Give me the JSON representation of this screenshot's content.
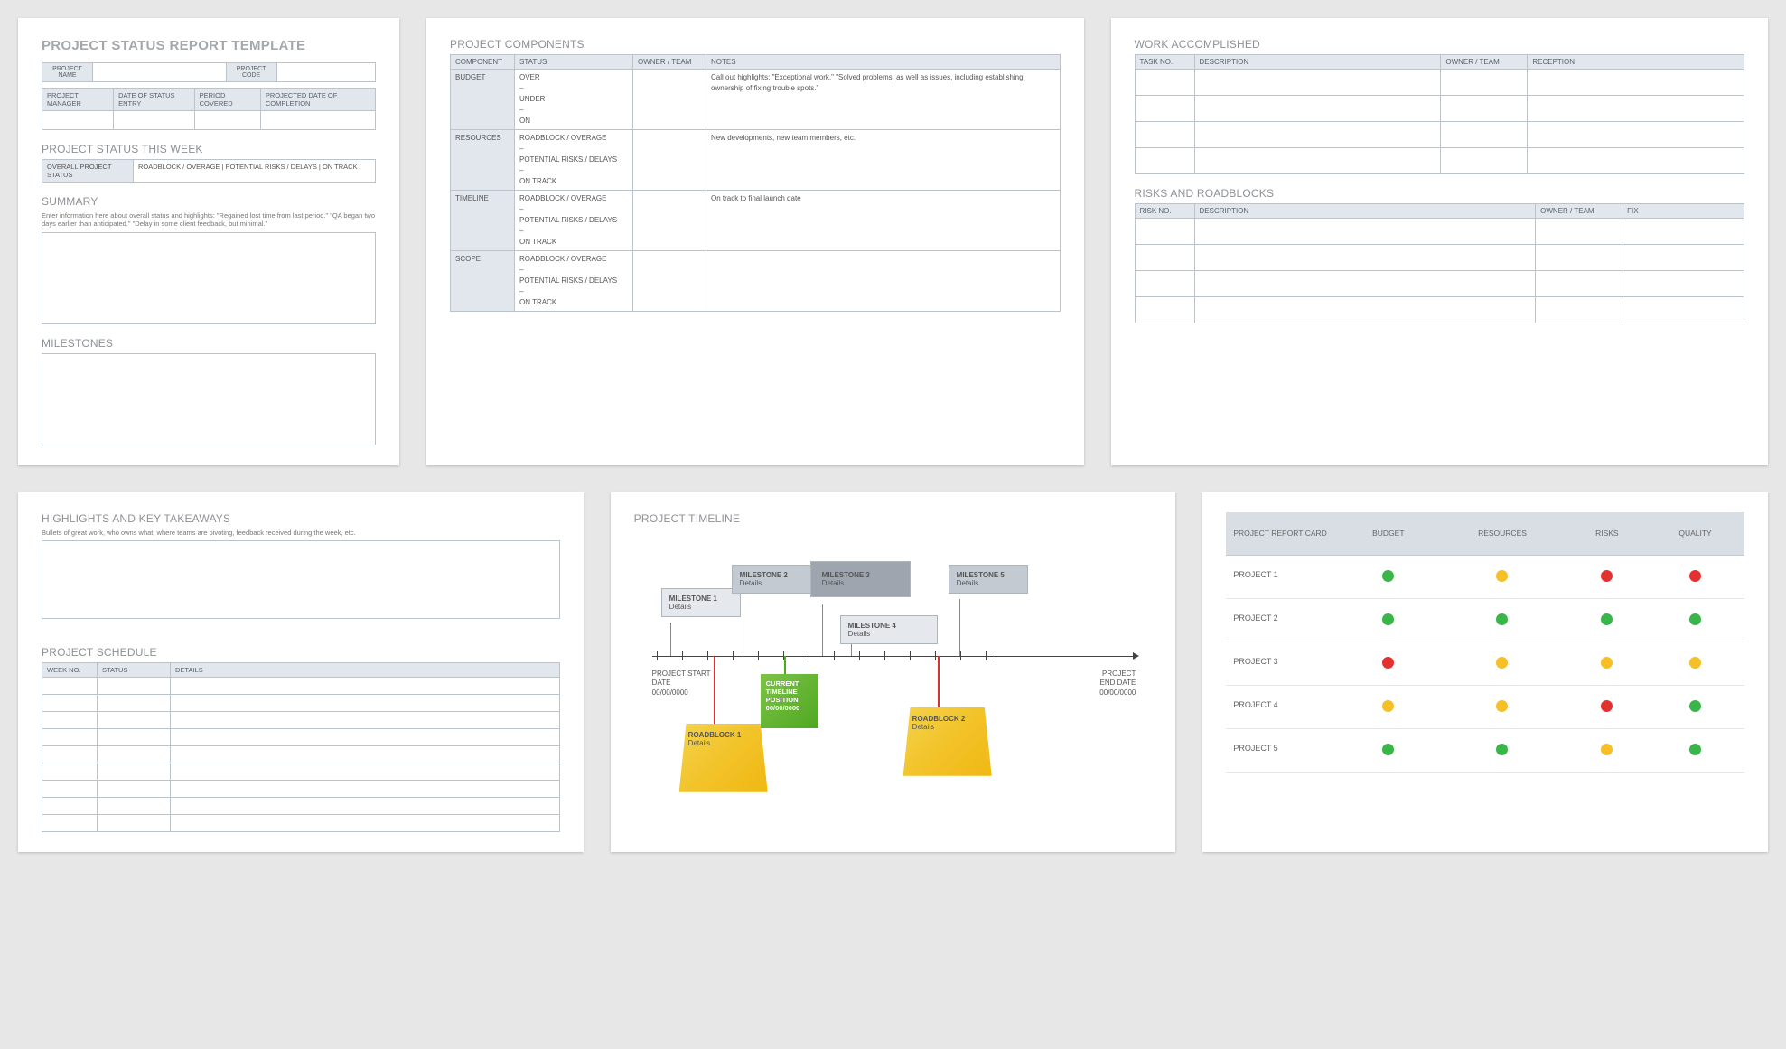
{
  "page1": {
    "title": "PROJECT STATUS REPORT TEMPLATE",
    "hdr1": {
      "name_lbl": "PROJECT NAME",
      "code_lbl": "PROJECT CODE"
    },
    "hdr2": {
      "c1": "PROJECT MANAGER",
      "c2": "DATE OF STATUS ENTRY",
      "c3": "PERIOD COVERED",
      "c4": "PROJECTED DATE OF COMPLETION"
    },
    "status_week": "PROJECT STATUS THIS WEEK",
    "status_lbl": "OVERALL PROJECT STATUS",
    "status_opts": "ROADBLOCK / OVERAGE    |    POTENTIAL RISKS / DELAYS    |    ON TRACK",
    "summary": "SUMMARY",
    "summary_hint": "Enter information here about overall status and highlights: \"Regained lost time from last period.\" \"QA began two days earlier than anticipated.\" \"Delay in some client feedback, but minimal.\"",
    "milestones": "MILESTONES"
  },
  "page2": {
    "title": "PROJECT COMPONENTS",
    "cols": {
      "c1": "COMPONENT",
      "c2": "STATUS",
      "c3": "OWNER / TEAM",
      "c4": "NOTES"
    },
    "rows": [
      {
        "name": "BUDGET",
        "status": "OVER\n–\nUNDER\n–\nON",
        "notes": "Call out highlights: \"Exceptional work.\" \"Solved problems, as well as issues, including establishing ownership of fixing trouble spots.\""
      },
      {
        "name": "RESOURCES",
        "status": "ROADBLOCK / OVERAGE\n–\nPOTENTIAL RISKS / DELAYS\n–\nON TRACK",
        "notes": "New developments, new team members, etc."
      },
      {
        "name": "TIMELINE",
        "status": "ROADBLOCK / OVERAGE\n–\nPOTENTIAL RISKS / DELAYS\n–\nON TRACK",
        "notes": "On track to final launch date"
      },
      {
        "name": "SCOPE",
        "status": "ROADBLOCK / OVERAGE\n–\nPOTENTIAL RISKS / DELAYS\n–\nON TRACK",
        "notes": ""
      }
    ]
  },
  "page3": {
    "wa_title": "WORK ACCOMPLISHED",
    "wa_cols": {
      "c1": "TASK NO.",
      "c2": "DESCRIPTION",
      "c3": "OWNER / TEAM",
      "c4": "RECEPTION"
    },
    "rr_title": "RISKS AND ROADBLOCKS",
    "rr_cols": {
      "c1": "RISK NO.",
      "c2": "DESCRIPTION",
      "c3": "OWNER / TEAM",
      "c4": "FIX"
    }
  },
  "page4": {
    "hl_title": "HIGHLIGHTS AND KEY TAKEAWAYS",
    "hl_hint": "Bullets of great work, who owns what, where teams are pivoting, feedback received during the week, etc.",
    "sched_title": "PROJECT SCHEDULE",
    "sched_cols": {
      "c1": "WEEK NO.",
      "c2": "STATUS",
      "c3": "DETAILS"
    }
  },
  "page5": {
    "title": "PROJECT TIMELINE",
    "milestones": [
      {
        "t": "MILESTONE 1",
        "d": "Details"
      },
      {
        "t": "MILESTONE 2",
        "d": "Details"
      },
      {
        "t": "MILESTONE 3",
        "d": "Details"
      },
      {
        "t": "MILESTONE 4",
        "d": "Details"
      },
      {
        "t": "MILESTONE 5",
        "d": "Details"
      }
    ],
    "roadblocks": [
      {
        "t": "ROADBLOCK 1",
        "d": "Details"
      },
      {
        "t": "ROADBLOCK 2",
        "d": "Details"
      }
    ],
    "current": {
      "l1": "CURRENT",
      "l2": "TIMELINE",
      "l3": "POSITION",
      "l4": "00/00/0000"
    },
    "start": {
      "l1": "PROJECT START",
      "l2": "DATE",
      "l3": "00/00/0000"
    },
    "end": {
      "l1": "PROJECT",
      "l2": "END DATE",
      "l3": "00/00/0000"
    }
  },
  "page6": {
    "head": {
      "c0": "PROJECT REPORT CARD",
      "c1": "BUDGET",
      "c2": "RESOURCES",
      "c3": "RISKS",
      "c4": "QUALITY"
    },
    "rows": [
      {
        "name": "PROJECT 1",
        "v": [
          "g",
          "y",
          "r",
          "r"
        ]
      },
      {
        "name": "PROJECT 2",
        "v": [
          "g",
          "g",
          "g",
          "g"
        ]
      },
      {
        "name": "PROJECT 3",
        "v": [
          "r",
          "y",
          "y",
          "y"
        ]
      },
      {
        "name": "PROJECT 4",
        "v": [
          "y",
          "y",
          "r",
          "g"
        ]
      },
      {
        "name": "PROJECT 5",
        "v": [
          "g",
          "g",
          "y",
          "g"
        ]
      }
    ]
  }
}
